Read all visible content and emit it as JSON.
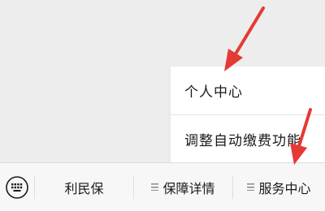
{
  "popup_menu": {
    "items": [
      {
        "label": "个人中心"
      },
      {
        "label": "调整自动缴费功能"
      }
    ]
  },
  "menubar": {
    "keyboard_icon": "keyboard-icon",
    "items": [
      {
        "label": "利民保",
        "has_submenu": false
      },
      {
        "label": "保障详情",
        "has_submenu": true
      },
      {
        "label": "服务中心",
        "has_submenu": true
      }
    ]
  },
  "annotation": {
    "arrow_color": "#e53935"
  },
  "colors": {
    "background": "#ededed",
    "menubar_bg": "#f7f7f7",
    "popup_bg": "#ffffff",
    "text": "#1a1a1a"
  }
}
